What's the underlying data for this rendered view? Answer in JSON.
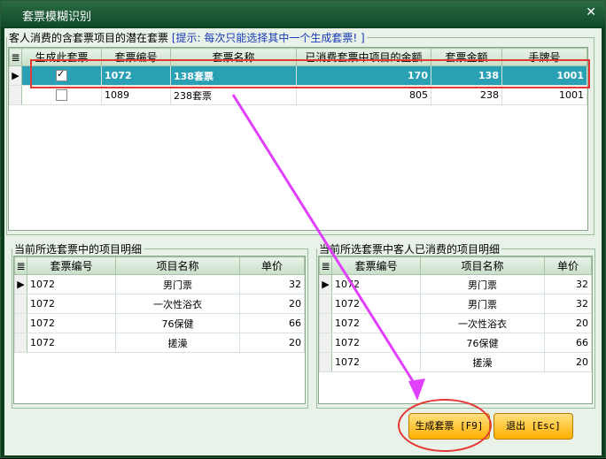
{
  "window": {
    "title": "套票模糊识别",
    "close_icon": "close-icon"
  },
  "top_group": {
    "legend_prefix": "客人消费的含套票项目的潜在套票",
    "legend_hint": "[提示: 每次只能选择其中一个生成套票! ]",
    "columns": [
      "生成此套票",
      "套票编号",
      "套票名称",
      "已消费套票中项目的金额",
      "套票金额",
      "手牌号"
    ],
    "rows": [
      {
        "checked": true,
        "code": "1072",
        "name": "138套票",
        "consumed": "170",
        "amount": "138",
        "hand": "1001",
        "selected": true
      },
      {
        "checked": false,
        "code": "1089",
        "name": "238套票",
        "consumed": "805",
        "amount": "238",
        "hand": "1001",
        "selected": false
      }
    ]
  },
  "left_group": {
    "legend": "当前所选套票中的项目明细",
    "columns": [
      "套票编号",
      "项目名称",
      "单价"
    ],
    "rows": [
      {
        "code": "1072",
        "item": "男门票",
        "price": "32"
      },
      {
        "code": "1072",
        "item": "一次性浴衣",
        "price": "20"
      },
      {
        "code": "1072",
        "item": "76保健",
        "price": "66"
      },
      {
        "code": "1072",
        "item": "搓澡",
        "price": "20"
      }
    ]
  },
  "right_group": {
    "legend": "当前所选套票中客人已消费的项目明细",
    "columns": [
      "套票编号",
      "项目名称",
      "单价"
    ],
    "rows": [
      {
        "code": "1072",
        "item": "男门票",
        "price": "32"
      },
      {
        "code": "1072",
        "item": "男门票",
        "price": "32"
      },
      {
        "code": "1072",
        "item": "一次性浴衣",
        "price": "20"
      },
      {
        "code": "1072",
        "item": "76保健",
        "price": "66"
      },
      {
        "code": "1072",
        "item": "搓澡",
        "price": "20"
      }
    ]
  },
  "buttons": {
    "generate": "生成套票 [F9]",
    "exit": "退出 [Esc]"
  },
  "colors": {
    "accent": "#2aa0b5",
    "annotation": "#e53935",
    "arrow": "#e040fb"
  }
}
